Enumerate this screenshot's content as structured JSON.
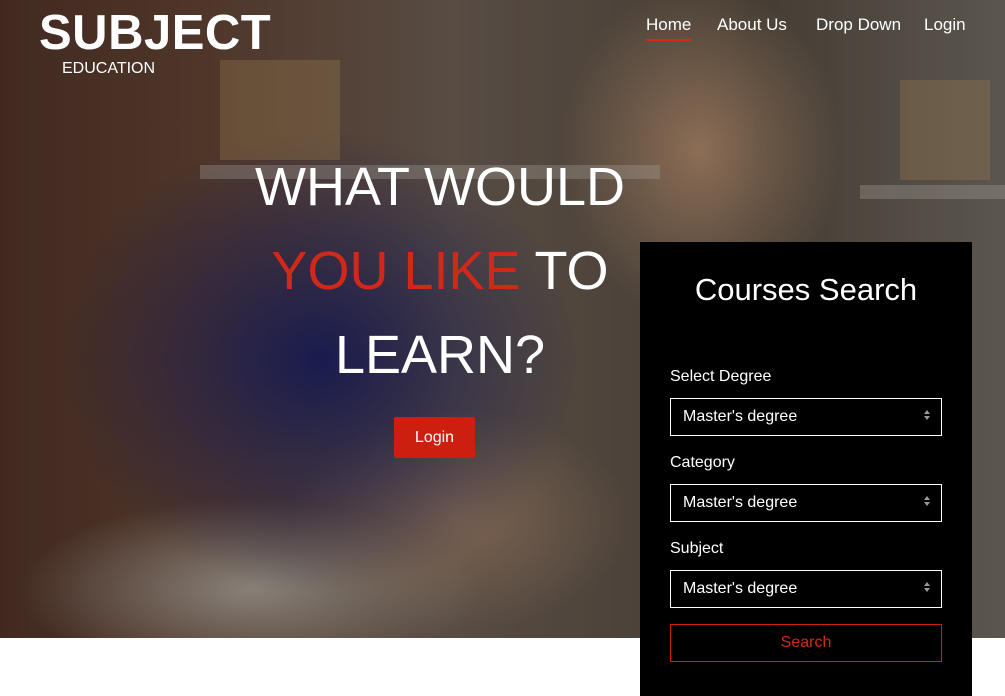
{
  "brand": {
    "title": "SUBJECT",
    "subtitle": "EDUCATION"
  },
  "nav": {
    "items": [
      {
        "label": "Home",
        "active": true
      },
      {
        "label": "About Us",
        "active": false
      },
      {
        "label": "Drop Down",
        "active": false
      },
      {
        "label": "Login",
        "active": false
      }
    ]
  },
  "hero": {
    "headline_line1": "WHAT WOULD",
    "headline_accent": "YOU LIKE",
    "headline_line2_rest": " TO",
    "headline_line3": "LEARN?",
    "login_button": "Login"
  },
  "search_panel": {
    "title": "Courses Search",
    "fields": [
      {
        "label": "Select Degree",
        "value": "Master's degree"
      },
      {
        "label": "Category",
        "value": "Master's degree"
      },
      {
        "label": "Subject",
        "value": "Master's degree"
      }
    ],
    "search_button": "Search"
  },
  "colors": {
    "accent": "#d2281a",
    "panel_bg": "#000000",
    "text": "#ffffff"
  },
  "icons": {
    "select_arrows": "updown-arrows-icon"
  }
}
